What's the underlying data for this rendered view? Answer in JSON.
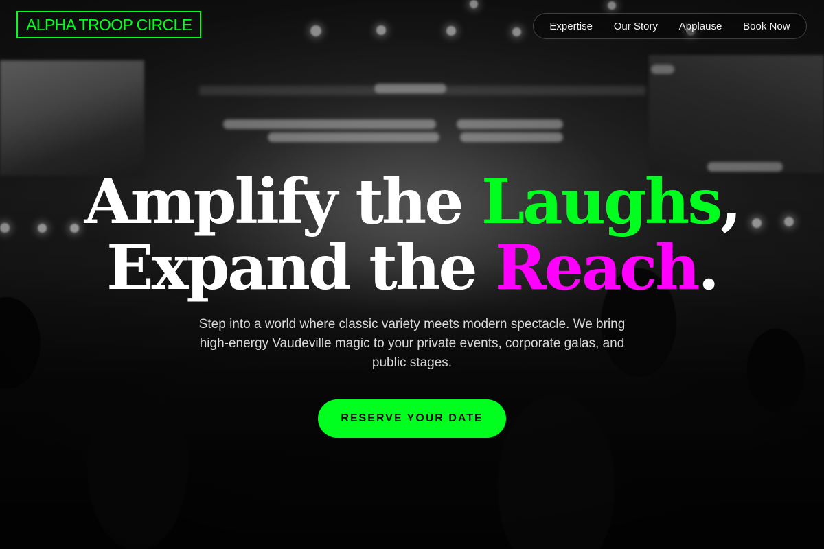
{
  "brand": {
    "logo_text": "ALPHA TROOP CIRCLE"
  },
  "nav": {
    "items": [
      {
        "label": "Expertise"
      },
      {
        "label": "Our Story"
      },
      {
        "label": "Applause"
      },
      {
        "label": "Book Now"
      }
    ]
  },
  "hero": {
    "line1_prefix": "Amplify the ",
    "line1_highlight": "Laughs",
    "line1_suffix": ",",
    "line2_prefix": "Expand the ",
    "line2_highlight": "Reach",
    "line2_suffix": ".",
    "subtitle": "Step into a world where classic variety meets modern spectacle. We bring high-energy Vaudeville magic to your private events, corporate galas, and public stages.",
    "cta_label": "RESERVE YOUR DATE"
  },
  "colors": {
    "accent_green": "#00ff1e",
    "accent_magenta": "#ff00ff",
    "background": "#111111"
  },
  "background_image": {
    "subject": "concert-crowd-photo"
  }
}
